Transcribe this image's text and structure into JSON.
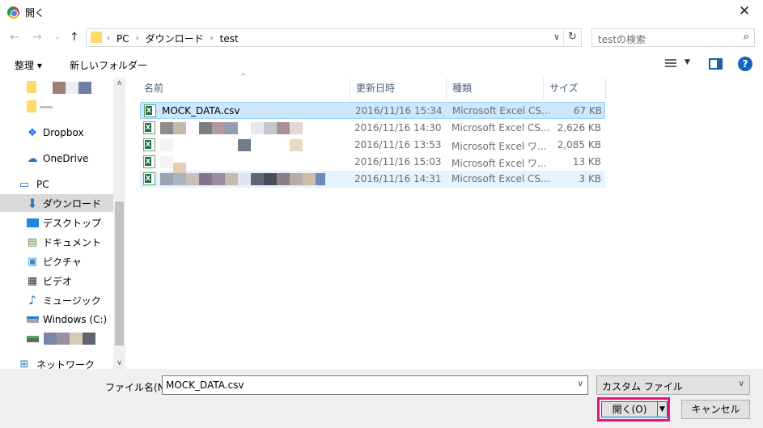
{
  "window": {
    "title": "開く",
    "close_glyph": "✕"
  },
  "nav": {
    "back_glyph": "←",
    "forward_glyph": "→",
    "recent_glyph": "⌄",
    "up_glyph": "↑"
  },
  "address": {
    "crumbs": [
      "PC",
      "ダウンロード",
      "test"
    ],
    "sep_glyph": "›",
    "dropdown_glyph": "∨",
    "refresh_glyph": "↻"
  },
  "search": {
    "placeholder": "testの検索",
    "icon_glyph": "⌕"
  },
  "toolbar": {
    "organize": "整理 ▾",
    "new_folder": "新しいフォルダー",
    "view_dd": "▼",
    "help": "?"
  },
  "sidebar": {
    "items": [
      {
        "label": "Dropbox",
        "icon": "dropbox-icon"
      },
      {
        "label": "OneDrive",
        "icon": "onedrive-icon"
      },
      {
        "label": "PC",
        "icon": "pc-icon"
      },
      {
        "label": "ダウンロード",
        "icon": "download-icon",
        "selected": true
      },
      {
        "label": "デスクトップ",
        "icon": "desktop-icon"
      },
      {
        "label": "ドキュメント",
        "icon": "documents-icon"
      },
      {
        "label": "ピクチャ",
        "icon": "pictures-icon"
      },
      {
        "label": "ビデオ",
        "icon": "video-icon"
      },
      {
        "label": "ミュージック",
        "icon": "music-icon"
      },
      {
        "label": "Windows (C:)",
        "icon": "drive-icon"
      },
      {
        "label": "ネットワーク",
        "icon": "network-icon"
      }
    ],
    "scroll_up": "∧",
    "scroll_down": "∨"
  },
  "filelist": {
    "columns": [
      "名前",
      "更新日時",
      "種類",
      "サイズ"
    ],
    "sort_caret": "^",
    "rows": [
      {
        "name": "MOCK_DATA.csv",
        "date": "2016/11/16 15:34",
        "type": "Microsoft Excel CS...",
        "size": "67 KB"
      },
      {
        "name": "",
        "date": "2016/11/16 14:30",
        "type": "Microsoft Excel CS...",
        "size": "2,626 KB"
      },
      {
        "name": "",
        "date": "2016/11/16 13:53",
        "type": "Microsoft Excel ワ...",
        "size": "2,085 KB"
      },
      {
        "name": "",
        "date": "2016/11/16 15:03",
        "type": "Microsoft Excel ワ...",
        "size": "13 KB"
      },
      {
        "name": "",
        "date": "2016/11/16 14:31",
        "type": "Microsoft Excel CS...",
        "size": "3 KB"
      }
    ]
  },
  "bottom": {
    "filename_label": "ファイル名(N):",
    "filename_value": "MOCK_DATA.csv",
    "filter_value": "カスタム ファイル",
    "dropdown_glyph": "∨",
    "open_label": "開く(O)",
    "split_glyph": "▼",
    "cancel_label": "キャンセル"
  },
  "colors": {
    "accent": "#0078d7",
    "selection": "#cce8ff",
    "highlight_border": "#e6177a"
  }
}
